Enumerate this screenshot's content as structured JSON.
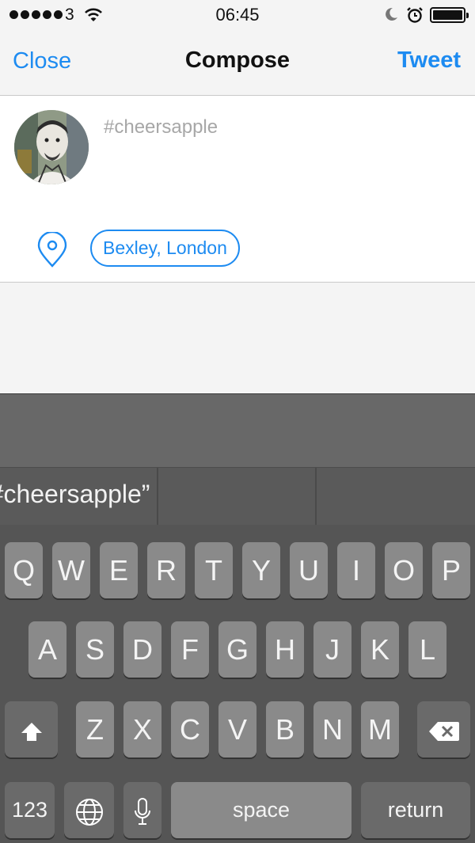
{
  "status_bar": {
    "carrier": "3",
    "time": "06:45"
  },
  "nav": {
    "close_label": "Close",
    "title": "Compose",
    "tweet_label": "Tweet"
  },
  "compose": {
    "text": "#cheersapple",
    "location": "Bexley, London"
  },
  "keyboard": {
    "suggestion": "“#cheersapple”",
    "row1": [
      "Q",
      "W",
      "E",
      "R",
      "T",
      "Y",
      "U",
      "I",
      "O",
      "P"
    ],
    "row2": [
      "A",
      "S",
      "D",
      "F",
      "G",
      "H",
      "J",
      "K",
      "L"
    ],
    "row3": [
      "Z",
      "X",
      "C",
      "V",
      "B",
      "N",
      "M"
    ],
    "numbers_label": "123",
    "space_label": "space",
    "return_label": "return"
  },
  "colors": {
    "accent": "#1d8bf1",
    "keyboard_bg": "#555555",
    "key_bg": "#8a8a8a"
  },
  "icons": [
    "wifi-icon",
    "moon-icon",
    "alarm-icon",
    "battery-icon",
    "location-pin-icon",
    "shift-icon",
    "backspace-icon",
    "globe-icon",
    "microphone-icon"
  ]
}
